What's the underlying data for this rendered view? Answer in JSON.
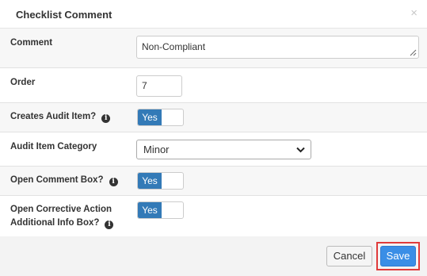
{
  "dialog": {
    "title": "Checklist Comment",
    "close_glyph": "×"
  },
  "fields": {
    "comment": {
      "label": "Comment",
      "value": "Non-Compliant"
    },
    "order": {
      "label": "Order",
      "value": "7"
    },
    "creates_audit_item": {
      "label": "Creates Audit Item?",
      "toggle": "Yes",
      "info_icon": "info-circle-icon"
    },
    "audit_item_category": {
      "label": "Audit Item Category",
      "selected": "Minor"
    },
    "open_comment_box": {
      "label": "Open Comment Box?",
      "toggle": "Yes",
      "info_icon": "info-circle-icon"
    },
    "open_corrective_action": {
      "label_line1": "Open Corrective Action",
      "label_line2": "Additional Info Box?",
      "toggle": "Yes",
      "info_icon": "info-circle-icon"
    }
  },
  "footer": {
    "cancel_label": "Cancel",
    "save_label": "Save"
  },
  "colors": {
    "primary": "#337ab7",
    "save": "#3a8ee6",
    "highlight": "#e03b3b"
  }
}
